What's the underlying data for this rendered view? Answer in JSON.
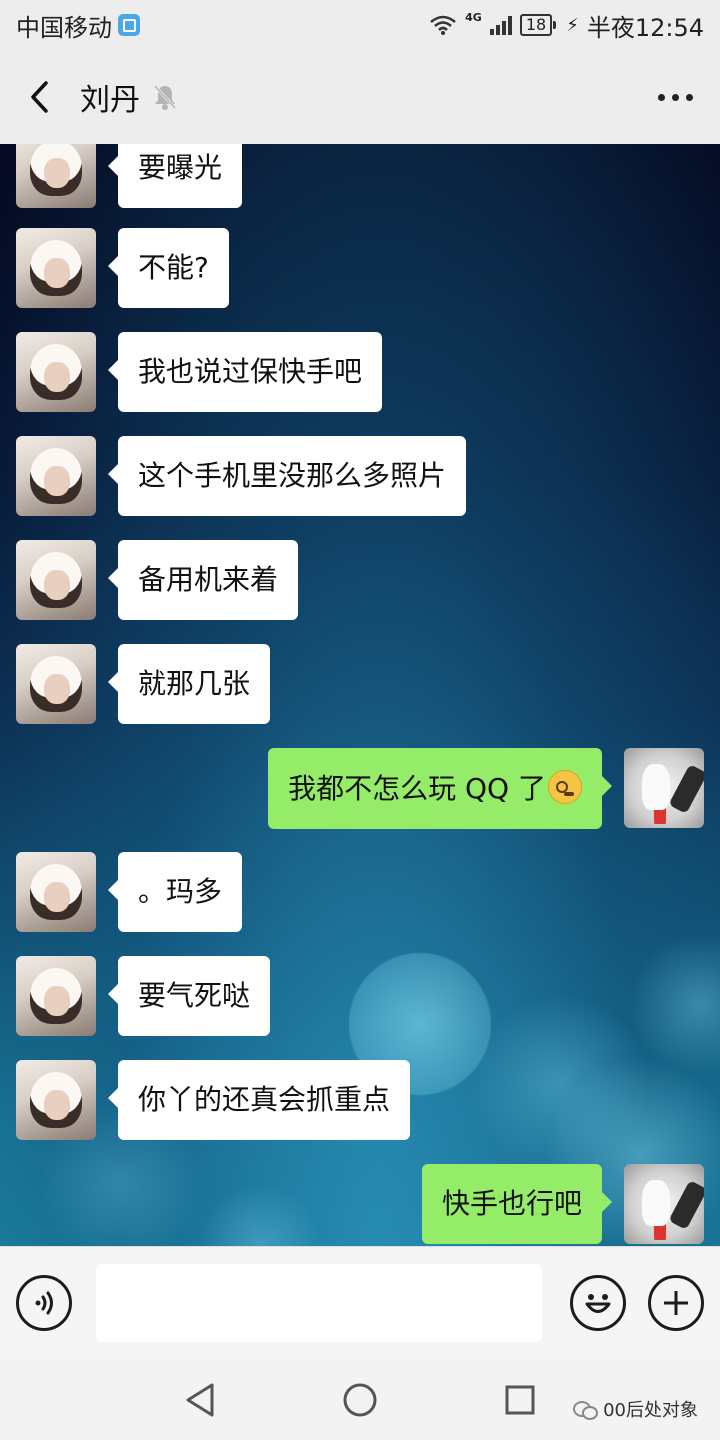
{
  "status_bar": {
    "carrier": "中国移动",
    "network": "4G",
    "battery": "18",
    "time": "半夜12:54",
    "icons": [
      "carrier-badge-icon",
      "wifi-icon",
      "signal-icon",
      "battery-icon",
      "charging-bolt-icon"
    ]
  },
  "header": {
    "title": "刘丹",
    "muted": true,
    "icons": [
      "back-chevron-icon",
      "muted-bell-icon",
      "more-dots-icon"
    ]
  },
  "messages": [
    {
      "side": "left",
      "text": "要曝光"
    },
    {
      "side": "left",
      "text": "不能?"
    },
    {
      "side": "left",
      "text": "我也说过保快手吧"
    },
    {
      "side": "left",
      "text": "这个手机里没那么多照片"
    },
    {
      "side": "left",
      "text": "备用机来着"
    },
    {
      "side": "left",
      "text": "就那几张"
    },
    {
      "side": "right",
      "text": "我都不怎么玩 QQ 了",
      "emoji": "thinking-face-emoji"
    },
    {
      "side": "left",
      "text": "。玛多"
    },
    {
      "side": "left",
      "text": "要气死哒"
    },
    {
      "side": "left",
      "text": "你丫的还真会抓重点"
    },
    {
      "side": "right",
      "text": "快手也行吧"
    }
  ],
  "input_bar": {
    "message_value": "",
    "icons": [
      "voice-icon",
      "emoji-icon",
      "plus-icon"
    ]
  },
  "system_nav": {
    "icons": [
      "back-triangle-icon",
      "home-circle-icon",
      "recents-square-icon"
    ],
    "watermark": "00后处对象"
  }
}
